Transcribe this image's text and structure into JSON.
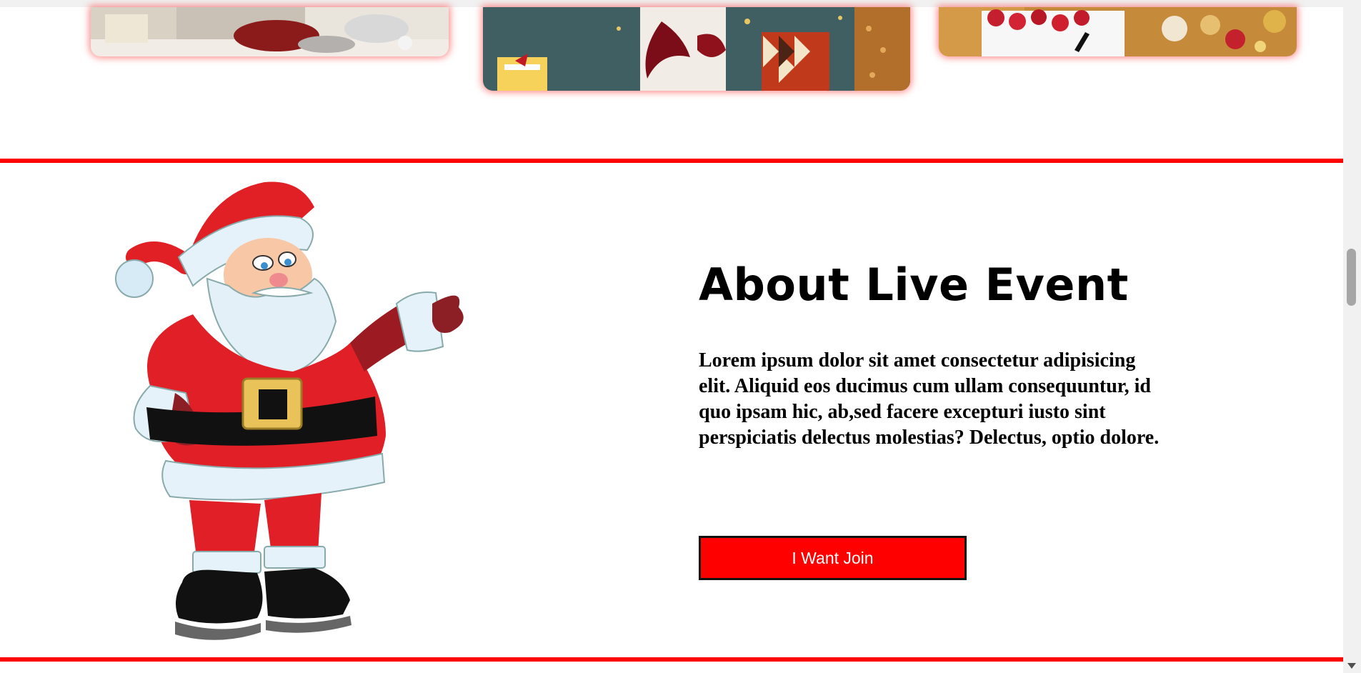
{
  "about": {
    "title": "About Live Event",
    "body": "Lorem ipsum dolor sit amet consectetur adipisicing elit. Aliquid eos ducimus cum ullam consequuntur, id quo ipsam hic, ab,sed facere excepturi iusto sint perspiciatis delectus molestias? Delectus, optio dolore.",
    "button_label": "I Want Join"
  },
  "colors": {
    "accent": "#ff0000",
    "button_text": "#ffffff",
    "text": "#000000"
  },
  "icons": {
    "scroll_down": "chevron-down-icon"
  }
}
